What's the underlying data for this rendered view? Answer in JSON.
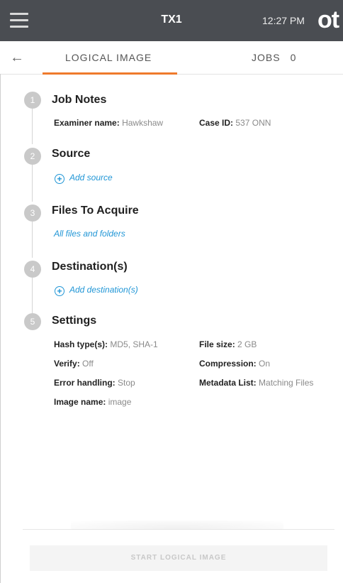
{
  "header": {
    "device_name": "TX1",
    "time": "12:27 PM",
    "logo_text": "ot",
    "menu_icon": "hamburger-menu-icon"
  },
  "tabs": {
    "back_icon": "arrow-left-icon",
    "logical_image_label": "LOGICAL IMAGE",
    "jobs_label": "JOBS",
    "jobs_count": "0",
    "active_color": "#ef7a2c"
  },
  "steps": {
    "job_notes": {
      "number": "1",
      "title": "Job Notes",
      "examiner_label": "Examiner name:",
      "examiner_value": "Hawkshaw",
      "case_label": "Case ID:",
      "case_value": "537 ONN"
    },
    "source": {
      "number": "2",
      "title": "Source",
      "add_label": "Add source"
    },
    "files": {
      "number": "3",
      "title": "Files To Acquire",
      "value": "All files and folders"
    },
    "destination": {
      "number": "4",
      "title": "Destination(s)",
      "add_label": "Add destination(s)"
    },
    "settings": {
      "number": "5",
      "title": "Settings",
      "hash_label": "Hash type(s):",
      "hash_value": "MD5, SHA-1",
      "file_size_label": "File size:",
      "file_size_value": "2 GB",
      "verify_label": "Verify:",
      "verify_value": "Off",
      "compression_label": "Compression:",
      "compression_value": "On",
      "error_label": "Error handling:",
      "error_value": "Stop",
      "metadata_label": "Metadata List:",
      "metadata_value": "Matching Files",
      "image_name_label": "Image name:",
      "image_name_value": "image"
    }
  },
  "footer": {
    "start_label": "START LOGICAL IMAGE"
  },
  "colors": {
    "header_bg": "#4a4d52",
    "link": "#2196d6",
    "step_circle": "#c9c9c9"
  }
}
